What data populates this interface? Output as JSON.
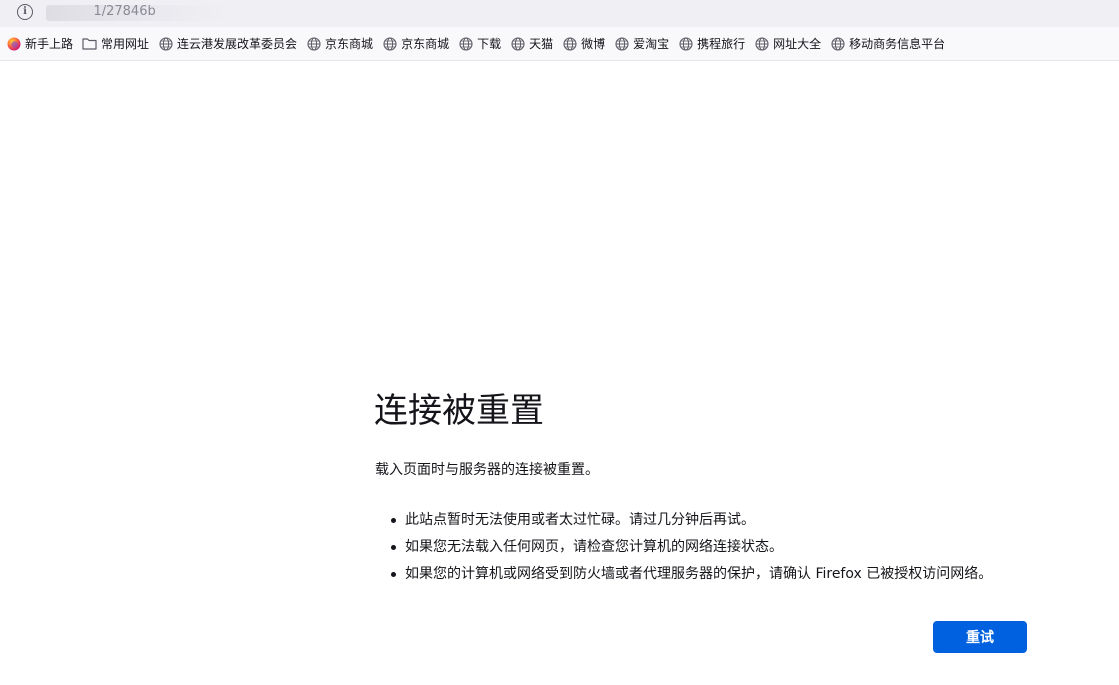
{
  "urlbar": {
    "info_icon": "info-icon",
    "url_visible_fragment": "​​      ​  ​   ​     ​    ​    ​  ​      ​        ​      ​   1/27846b"
  },
  "bookmarks": [
    {
      "icon": "firefox-icon",
      "label": "新手上路"
    },
    {
      "icon": "folder-icon",
      "label": "常用网址"
    },
    {
      "icon": "globe-icon",
      "label": "连云港发展改革委员会"
    },
    {
      "icon": "globe-icon",
      "label": "京东商城"
    },
    {
      "icon": "globe-icon",
      "label": "京东商城"
    },
    {
      "icon": "globe-icon",
      "label": "下载"
    },
    {
      "icon": "globe-icon",
      "label": "天猫"
    },
    {
      "icon": "globe-icon",
      "label": "微博"
    },
    {
      "icon": "globe-icon",
      "label": "爱淘宝"
    },
    {
      "icon": "globe-icon",
      "label": "携程旅行"
    },
    {
      "icon": "globe-icon",
      "label": "网址大全"
    },
    {
      "icon": "globe-icon",
      "label": "移动商务信息平台"
    }
  ],
  "error": {
    "title": "连接被重置",
    "description": "载入页面时与服务器的连接被重置。",
    "suggestions": [
      "此站点暂时无法使用或者太过忙碌。请过几分钟后再试。",
      "如果您无法载入任何网页，请检查您计算机的网络连接状态。",
      "如果您的计算机或网络受到防火墙或者代理服务器的保护，请确认 Firefox 已被授权访问网络。"
    ],
    "retry_label": "重试"
  },
  "colors": {
    "accent": "#0061e0",
    "text": "#15141a",
    "toolbar": "#f0f0f4"
  }
}
